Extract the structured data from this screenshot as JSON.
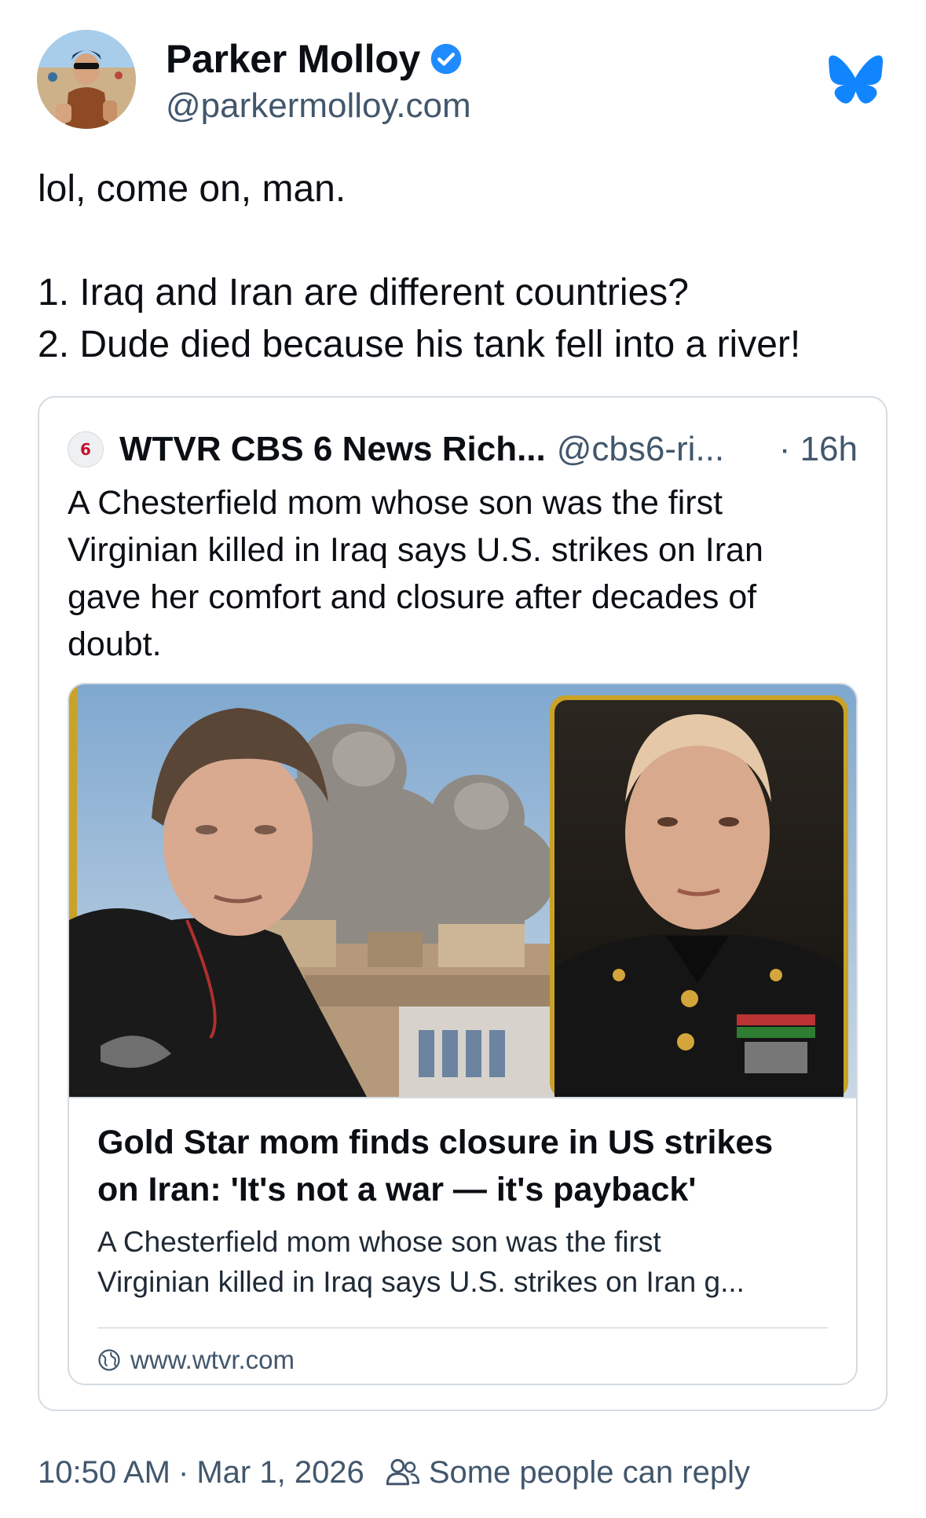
{
  "author": {
    "display_name": "Parker Molloy",
    "handle": "@parkermolloy.com",
    "verified": true,
    "avatar_icon": "user-avatar"
  },
  "post": {
    "lines": [
      "lol, come on, man.",
      "",
      "1. Iraq and Iran are different countries?",
      "2. Dude died because his tank fell into a river!"
    ]
  },
  "quoted_post": {
    "display_name": "WTVR CBS 6 News Rich...",
    "handle": "@cbs6-ri...",
    "time": "· 16h",
    "avatar_mark": "6",
    "text_lines": [
      "A Chesterfield mom whose son was the first",
      "Virginian killed in Iraq says U.S. strikes on Iran",
      "gave her comfort and closure after decades of",
      "doubt."
    ]
  },
  "link_card": {
    "title_lines": [
      "Gold Star mom finds closure in US strikes",
      "on Iran: 'It's not a war — it's payback'"
    ],
    "description_lines": [
      "A Chesterfield mom whose son was the first",
      "Virginian killed in Iraq says U.S. strikes on Iran g..."
    ],
    "domain": "www.wtvr.com",
    "image_description_icon": "news-thumbnail-image"
  },
  "footer": {
    "time": "10:50 AM",
    "separator": "·",
    "date": "Mar 1, 2026",
    "reply_setting": "Some people can reply"
  },
  "colors": {
    "brand_blue": "#1185fe",
    "verified_blue": "#208bfe",
    "muted_text": "#42576c",
    "border": "#d4dbe2",
    "image_frame_gold": "#c9a227"
  }
}
